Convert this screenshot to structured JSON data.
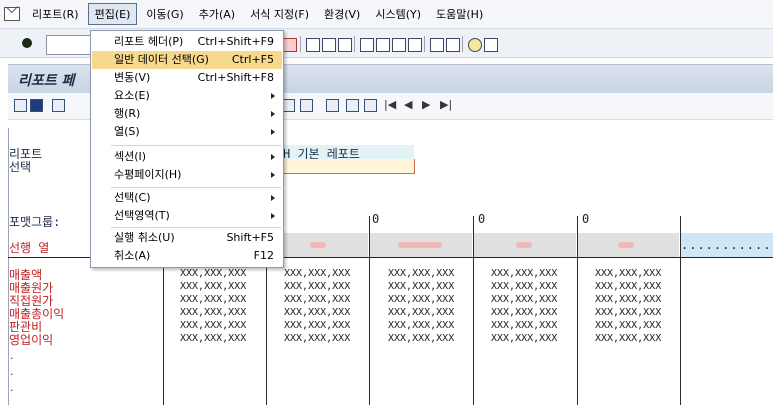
{
  "menubar": {
    "items": [
      {
        "label": "리포트(R)",
        "active": false
      },
      {
        "label": "편집(E)",
        "active": true
      },
      {
        "label": "이동(G)",
        "active": false
      },
      {
        "label": "추가(A)",
        "active": false
      },
      {
        "label": "서식 지정(F)",
        "active": false
      },
      {
        "label": "환경(V)",
        "active": false
      },
      {
        "label": "시스템(Y)",
        "active": false
      },
      {
        "label": "도움말(H)",
        "active": false
      }
    ]
  },
  "titlebar": {
    "title": "리포트 페"
  },
  "dropdown": {
    "items": [
      {
        "label": "리포트 헤더(P)",
        "shortcut": "Ctrl+Shift+F9",
        "highlighted": false,
        "submenu": false
      },
      {
        "label": "일반 데이터 선택(G)",
        "shortcut": "Ctrl+F5",
        "highlighted": true,
        "submenu": false
      },
      {
        "label": "변동(V)",
        "shortcut": "Ctrl+Shift+F8",
        "highlighted": false,
        "submenu": false
      },
      {
        "label": "요소(E)",
        "shortcut": "",
        "highlighted": false,
        "submenu": true
      },
      {
        "label": "행(R)",
        "shortcut": "",
        "highlighted": false,
        "submenu": true
      },
      {
        "label": "열(S)",
        "shortcut": "",
        "highlighted": false,
        "submenu": true
      },
      {
        "label": "섹션(I)",
        "shortcut": "",
        "highlighted": false,
        "submenu": true
      },
      {
        "label": "수평페이지(H)",
        "shortcut": "",
        "highlighted": false,
        "submenu": true
      },
      {
        "label": "선택(C)",
        "shortcut": "",
        "highlighted": false,
        "submenu": true
      },
      {
        "label": "선택영역(T)",
        "shortcut": "",
        "highlighted": false,
        "submenu": true
      },
      {
        "label": "실행 취소(U)",
        "shortcut": "Shift+F5",
        "highlighted": false,
        "submenu": false
      },
      {
        "label": "취소(A)",
        "shortcut": "F12",
        "highlighted": false,
        "submenu": false
      }
    ]
  },
  "report": {
    "left_label_1": "리포트",
    "left_label_2": "선택",
    "report_name_fragment": "H 기본 레포트",
    "format_group_label": "포맷그룹:",
    "selection_col_label": "선행 열",
    "col_numbers": [
      "0",
      "0",
      "0"
    ],
    "header_dots": "...........",
    "rows": [
      "매출액",
      "매출원가",
      "직접원가",
      "매출총이익",
      "판관비",
      "영업이익"
    ],
    "cell_value": "XXX,XXX,XXX",
    "columns_count": 5
  },
  "colors": {
    "menu_active": "#dfe7f3",
    "highlight": "#f6d98c",
    "row_label": "#c02020",
    "title_bar": "#c9d4e3"
  }
}
